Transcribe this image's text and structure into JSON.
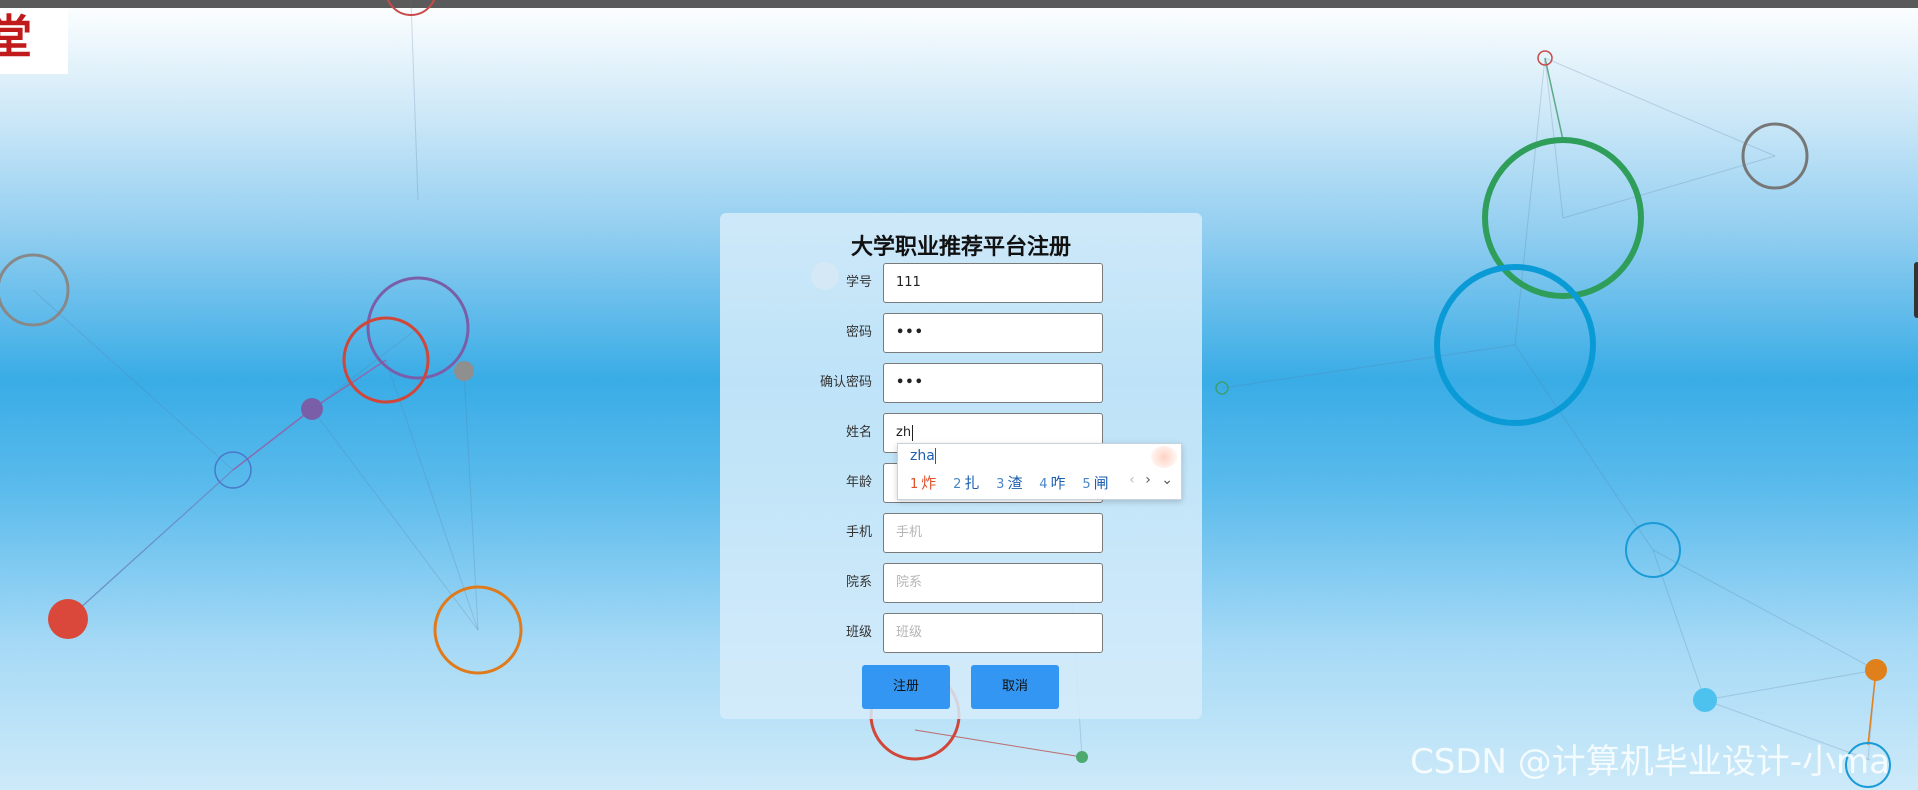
{
  "logo": {
    "glyph": "堂"
  },
  "form": {
    "title": "大学职业推荐平台注册",
    "fields": [
      {
        "label": "学号",
        "value": "111",
        "placeholder": ""
      },
      {
        "label": "密码",
        "value": "•••",
        "placeholder": ""
      },
      {
        "label": "确认密码",
        "value": "•••",
        "placeholder": ""
      },
      {
        "label": "姓名",
        "value": "zh",
        "placeholder": ""
      },
      {
        "label": "年龄",
        "value": "",
        "placeholder": ""
      },
      {
        "label": "手机",
        "value": "",
        "placeholder": "手机"
      },
      {
        "label": "院系",
        "value": "",
        "placeholder": "院系"
      },
      {
        "label": "班级",
        "value": "",
        "placeholder": "班级"
      }
    ],
    "register_label": "注册",
    "cancel_label": "取消"
  },
  "ime": {
    "pinyin": "zha",
    "candidates": [
      {
        "num": "1",
        "char": "炸"
      },
      {
        "num": "2",
        "char": "扎"
      },
      {
        "num": "3",
        "char": "渣"
      },
      {
        "num": "4",
        "char": "咋"
      },
      {
        "num": "5",
        "char": "闸"
      }
    ],
    "prev": "‹",
    "next": "›",
    "expand": "⌄"
  },
  "watermark": "CSDN @计算机毕业设计-小ma",
  "colors": {
    "accent": "#3296f2",
    "panel": "#d6ecfa",
    "selected_candidate": "#e0502a"
  }
}
